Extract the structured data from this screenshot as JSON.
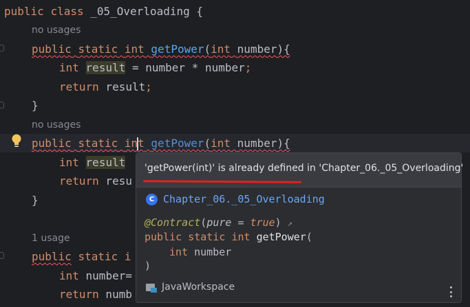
{
  "code": {
    "line1": {
      "kw1": "public",
      "kw2": "class",
      "name": "_05_Overloading",
      "brace": "{"
    },
    "hint1": "no usages",
    "m1_decl": {
      "kw1": "public",
      "kw2": "static",
      "type": "int",
      "name": "getPower",
      "param_type": "int",
      "param": "number",
      "close": "){"
    },
    "m1_body1": {
      "type": "int",
      "var": "result",
      "rest": " = number * number",
      "semi": ";"
    },
    "m1_body2": {
      "kw": "return",
      "rest": " result",
      "semi": ";"
    },
    "m1_close": "}",
    "hint2": "no usages",
    "m2_decl": {
      "kw1": "public",
      "kw2": "static",
      "type_a": "in",
      "type_b": "t",
      "name": "getPower",
      "param_type": "int",
      "param": "number",
      "close": "){"
    },
    "m2_body1": {
      "type": "int",
      "var": "result"
    },
    "m2_body2": {
      "kw": "return",
      "rest": " resu"
    },
    "m2_close": "}",
    "hint3": "1 usage",
    "m3_decl": {
      "kw1": "public",
      "kw2": "static",
      "rest": "i"
    },
    "m3_body1": {
      "type": "int",
      "rest": " number="
    },
    "m3_body2": {
      "kw": "return",
      "rest": " numb"
    }
  },
  "popup": {
    "message": "'getPower(int)' is already defined in 'Chapter_06._05_Overloading'",
    "class_icon": "C",
    "class_name": "Chapter_06._05_Overloading",
    "annotation": "@Contract",
    "annotation_args_open": "(",
    "annotation_arg_name": "pure",
    "annotation_eq": " = ",
    "annotation_arg_value": "true",
    "annotation_args_close": ")",
    "external_icon": "↗",
    "sig_kw1": "public",
    "sig_kw2": "static",
    "sig_type": "int",
    "sig_name": "getPower",
    "sig_open": "(",
    "param_type": "int",
    "param_name": "number",
    "sig_close": ")",
    "workspace": "JavaWorkspace"
  },
  "icons": {
    "bulb": "lightbulb-icon",
    "class": "class-icon",
    "folder": "folder-icon",
    "more": "more-vertical-icon"
  },
  "colors": {
    "background": "#1e1f22",
    "keyword": "#cf8e6d",
    "function": "#56a8f5",
    "error_underline": "#f75464",
    "annotation_underline": "#e3211b"
  }
}
